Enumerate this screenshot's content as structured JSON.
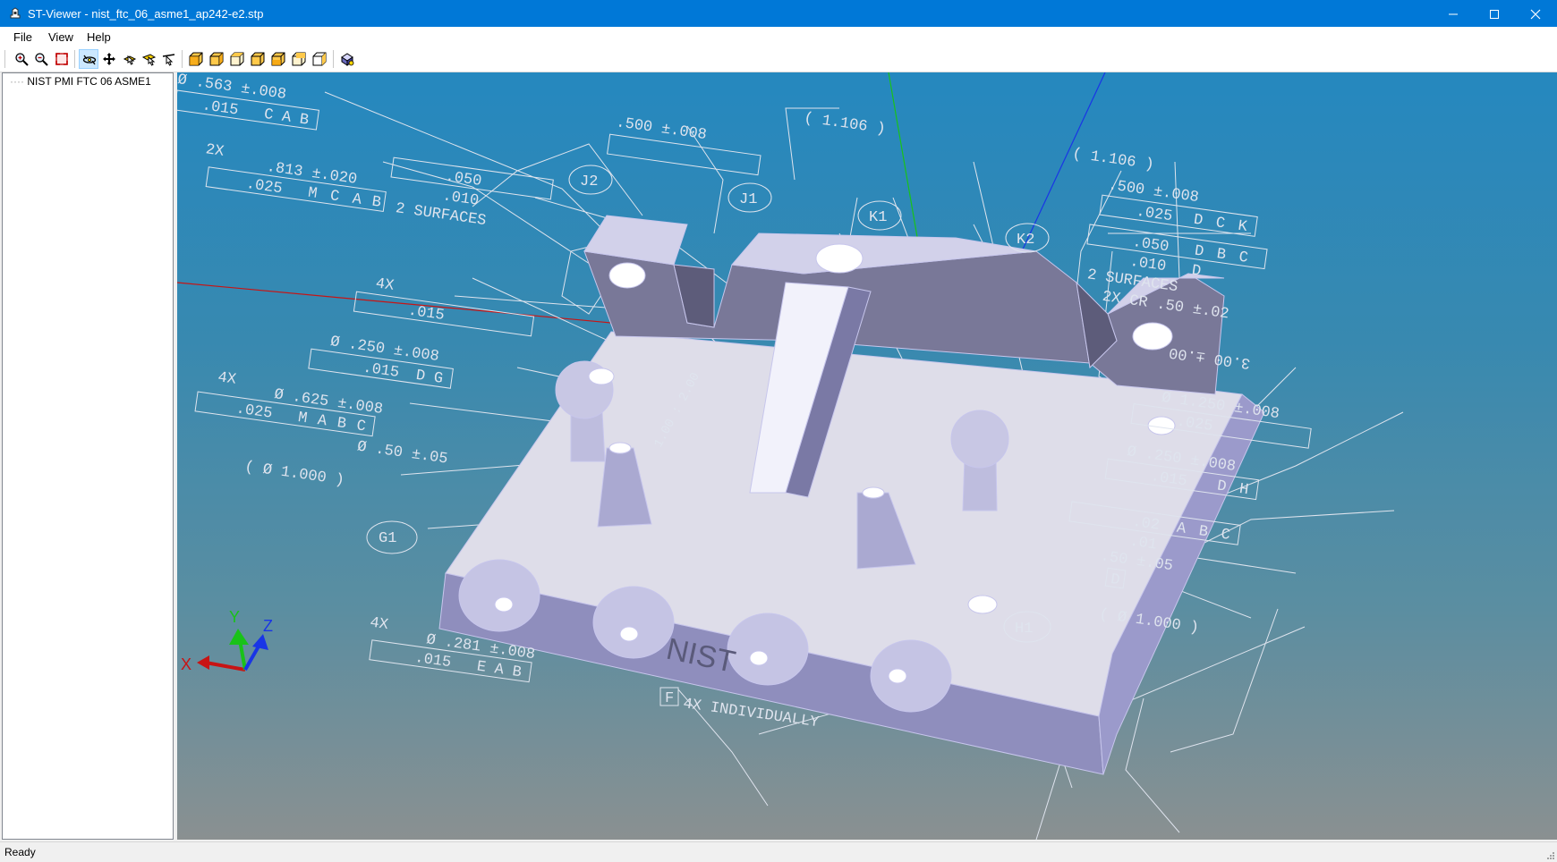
{
  "window": {
    "title": "ST-Viewer - nist_ftc_06_asme1_ap242-e2.stp"
  },
  "menu": [
    "File",
    "View",
    "Help"
  ],
  "toolbar": {
    "tools": [
      "zoom-in",
      "zoom-out",
      "fit-all",
      "rotate",
      "pan",
      "select-object",
      "select-face",
      "select-edge",
      "view-front",
      "view-back",
      "view-left",
      "view-right",
      "view-top",
      "view-bottom",
      "view-iso",
      "shading"
    ]
  },
  "tree": {
    "root": "NIST PMI FTC 06 ASME1"
  },
  "status": {
    "text": "Ready"
  },
  "pmi": {
    "a1": "Ø .563 ±.008",
    "a2": ".015",
    "a3": "C",
    "a4": "A",
    "a5": "B",
    "b0": "2X",
    "b1": ".813 ±.020",
    "b2": ".025",
    "b3": "M",
    "b4": "C",
    "b5": "A",
    "b6": "B",
    "c1": ".050",
    "c2": ".010",
    "c3": "2 SURFACES",
    "d1": "4X",
    "d2": ".015",
    "e1": "Ø .250 ±.008",
    "e2": ".015",
    "e3": "D",
    "e4": "G",
    "f1": "4X",
    "f2": "Ø .625 ±.008",
    "f3": ".025",
    "f4": "M",
    "f5": "A",
    "f6": "B",
    "f7": "C",
    "f8": "Ø .50 ±.05",
    "g1": "( Ø 1.000 )",
    "g2": "G1",
    "h1": "4X",
    "h2": "Ø .281 ±.008",
    "h3": ".015",
    "h4": "E",
    "h5": "A",
    "h6": "B",
    "i1": "F",
    "i2": "4X INDIVIDUALLY",
    "j1": ".500 ±.008",
    "j2": "( 1.106 )",
    "j3": "J2",
    "j4": "J1",
    "k1": "( 1.106 )",
    "k2": ".500 ±.008",
    "k3": ".025",
    "k4": "D",
    "k5": "C",
    "k6": "K",
    "k7": "K1",
    "k8": "K2",
    "l1": ".050",
    "l2": "D",
    "l3": "B",
    "l4": "C",
    "l5": ".010",
    "l6": "D",
    "l7": "2 SURFACES",
    "l8": "2X CR .50 ±.02",
    "m1": "3.00 ±.00",
    "m2": "Ø 1.250 ±.008",
    "m3": ".025",
    "m4": "Ø .250 ±.008",
    "m5": ".015",
    "m6": "D",
    "m7": "H",
    "n1": ".02",
    "n2": "A",
    "n3": "B",
    "n4": "C",
    "n5": ".01",
    "n6": ".50 ±.05",
    "n7": "D",
    "o1": "( Ø 1.000 )",
    "o2": "H1",
    "p1": "1.00 : 2.00",
    "q1": "NIST"
  },
  "triad": {
    "x": "X",
    "y": "Y",
    "z": "Z"
  },
  "colors": {
    "titlebar": "#0078d7",
    "viewport_top": "#2588bf",
    "viewport_bottom": "#8a9091",
    "part": "#8f8ebd",
    "pmi": "#dfe4ee",
    "x_axis": "#c81414",
    "y_axis": "#19c219",
    "z_axis": "#1935e6"
  }
}
